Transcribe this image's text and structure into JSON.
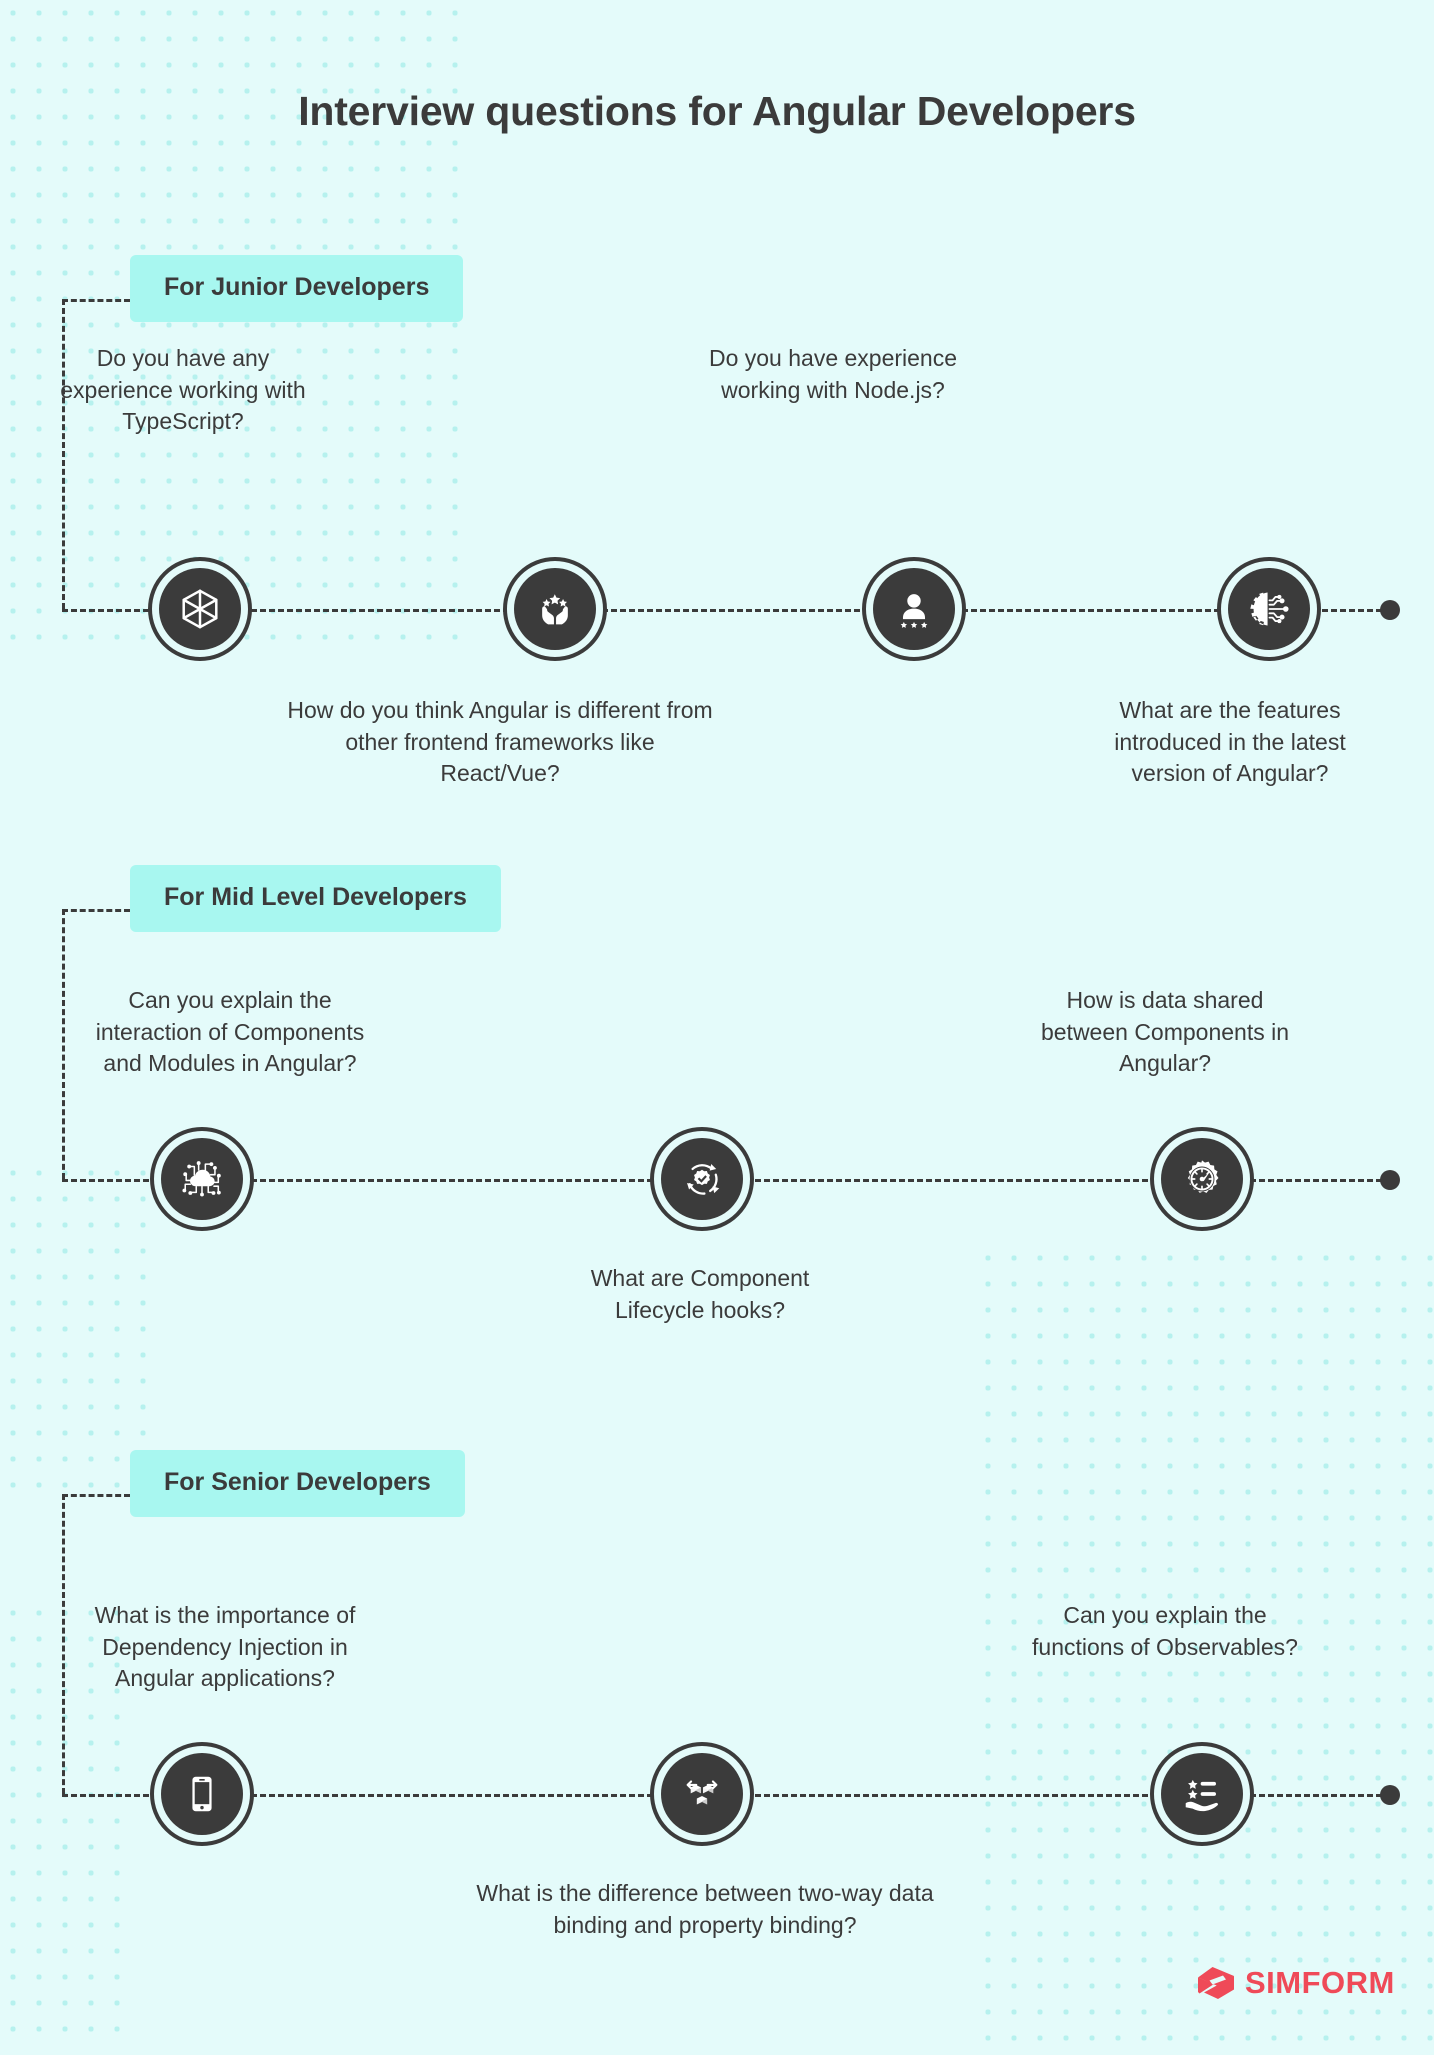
{
  "page": {
    "title": "Interview questions for Angular Developers",
    "background_color": "#e4fbfa",
    "dot_color": "#b6f1ee",
    "ink_color": "#3b3b3b",
    "badge_color": "#a8f7f0"
  },
  "sections": [
    {
      "badge": "For Junior Developers",
      "nodes": [
        {
          "icon": "cube-wireframe-icon",
          "question": "Do you have any experience working with TypeScript?",
          "position": "above"
        },
        {
          "icon": "hands-stars-icon",
          "question": "How do you think Angular is different from other frontend frameworks like React/Vue?",
          "position": "below"
        },
        {
          "icon": "person-stars-icon",
          "question": "Do you have experience working with Node.js?",
          "position": "above"
        },
        {
          "icon": "gear-circuit-icon",
          "question": "What are the features introduced in the latest version of Angular?",
          "position": "below"
        }
      ]
    },
    {
      "badge": "For Mid Level Developers",
      "nodes": [
        {
          "icon": "cloud-network-icon",
          "question": "Can you explain the interaction of Components and Modules in Angular?",
          "position": "above"
        },
        {
          "icon": "lifecycle-check-icon",
          "question": "What are Component Lifecycle hooks?",
          "position": "below"
        },
        {
          "icon": "gauge-gear-icon",
          "question": "How is data shared between Components in Angular?",
          "position": "above"
        }
      ]
    },
    {
      "badge": "For Senior Developers",
      "nodes": [
        {
          "icon": "smartphone-icon",
          "question": "What is the importance of Dependency Injection in Angular applications?",
          "position": "above"
        },
        {
          "icon": "cubes-arrows-icon",
          "question": "What is the difference between two-way data binding and property binding?",
          "position": "below"
        },
        {
          "icon": "hand-star-list-icon",
          "question": "Can you explain the functions of Observables?",
          "position": "above"
        }
      ]
    }
  ],
  "logo": {
    "word": "SIMFORM",
    "mark": "simform-s-mark-icon",
    "color": "#ef4a58"
  }
}
